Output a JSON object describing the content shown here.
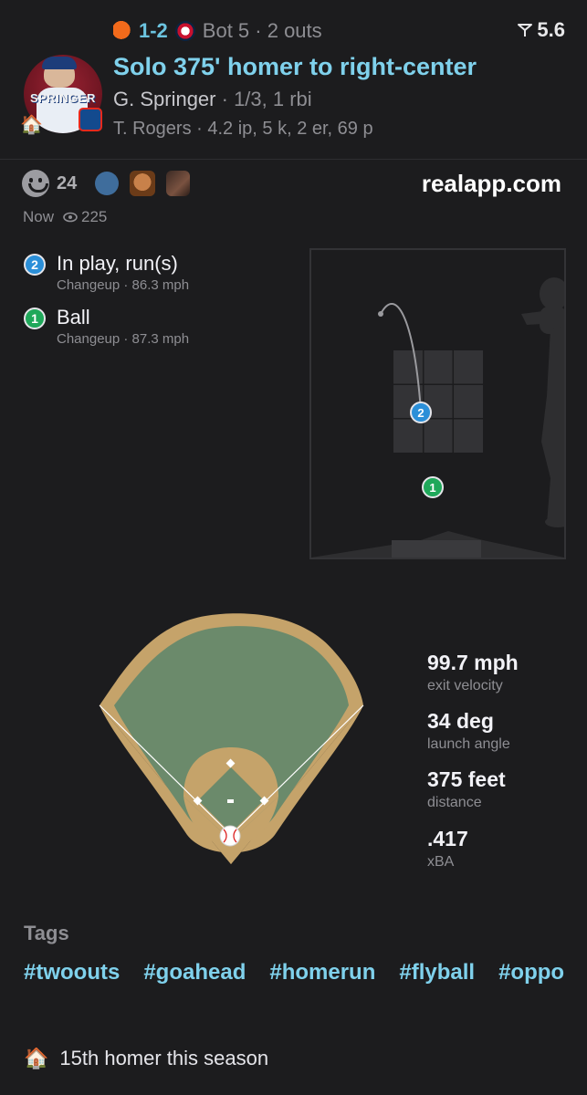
{
  "header": {
    "score": "1-2",
    "inning_info": "Bot 5 · 2 outs",
    "leverage": "5.6",
    "title": "Solo 375' homer to right-center",
    "batter_name": "G. Springer",
    "batter_stats": "· 1/3, 1 rbi",
    "pitcher_line": "T. Rogers · 4.2 ip, 5 k, 2 er, 69 p",
    "avatar_text": "SPRINGER",
    "home_emoji": "🏠"
  },
  "social": {
    "reaction_count": "24",
    "site": "realapp.com",
    "time": "Now",
    "views": "225"
  },
  "pitches": [
    {
      "num": "2",
      "result": "In play, run(s)",
      "detail": "Changeup · 86.3 mph",
      "color": "#2b8fd8"
    },
    {
      "num": "1",
      "result": "Ball",
      "detail": "Changeup · 87.3 mph",
      "color": "#1fa85a"
    }
  ],
  "hit_stats": [
    {
      "value": "99.7 mph",
      "label": "exit velocity"
    },
    {
      "value": "34 deg",
      "label": "launch angle"
    },
    {
      "value": "375 feet",
      "label": "distance"
    },
    {
      "value": ".417",
      "label": "xBA"
    }
  ],
  "tags_label": "Tags",
  "tags": [
    "#twoouts",
    "#goahead",
    "#homerun",
    "#flyball",
    "#oppo"
  ],
  "milestone": {
    "emoji": "🏠",
    "text": "15th homer this season"
  },
  "colors": {
    "accent": "#7fd1ec",
    "background": "#1c1c1e",
    "field_grass": "#6b8a6b",
    "field_dirt": "#c5a36a"
  }
}
